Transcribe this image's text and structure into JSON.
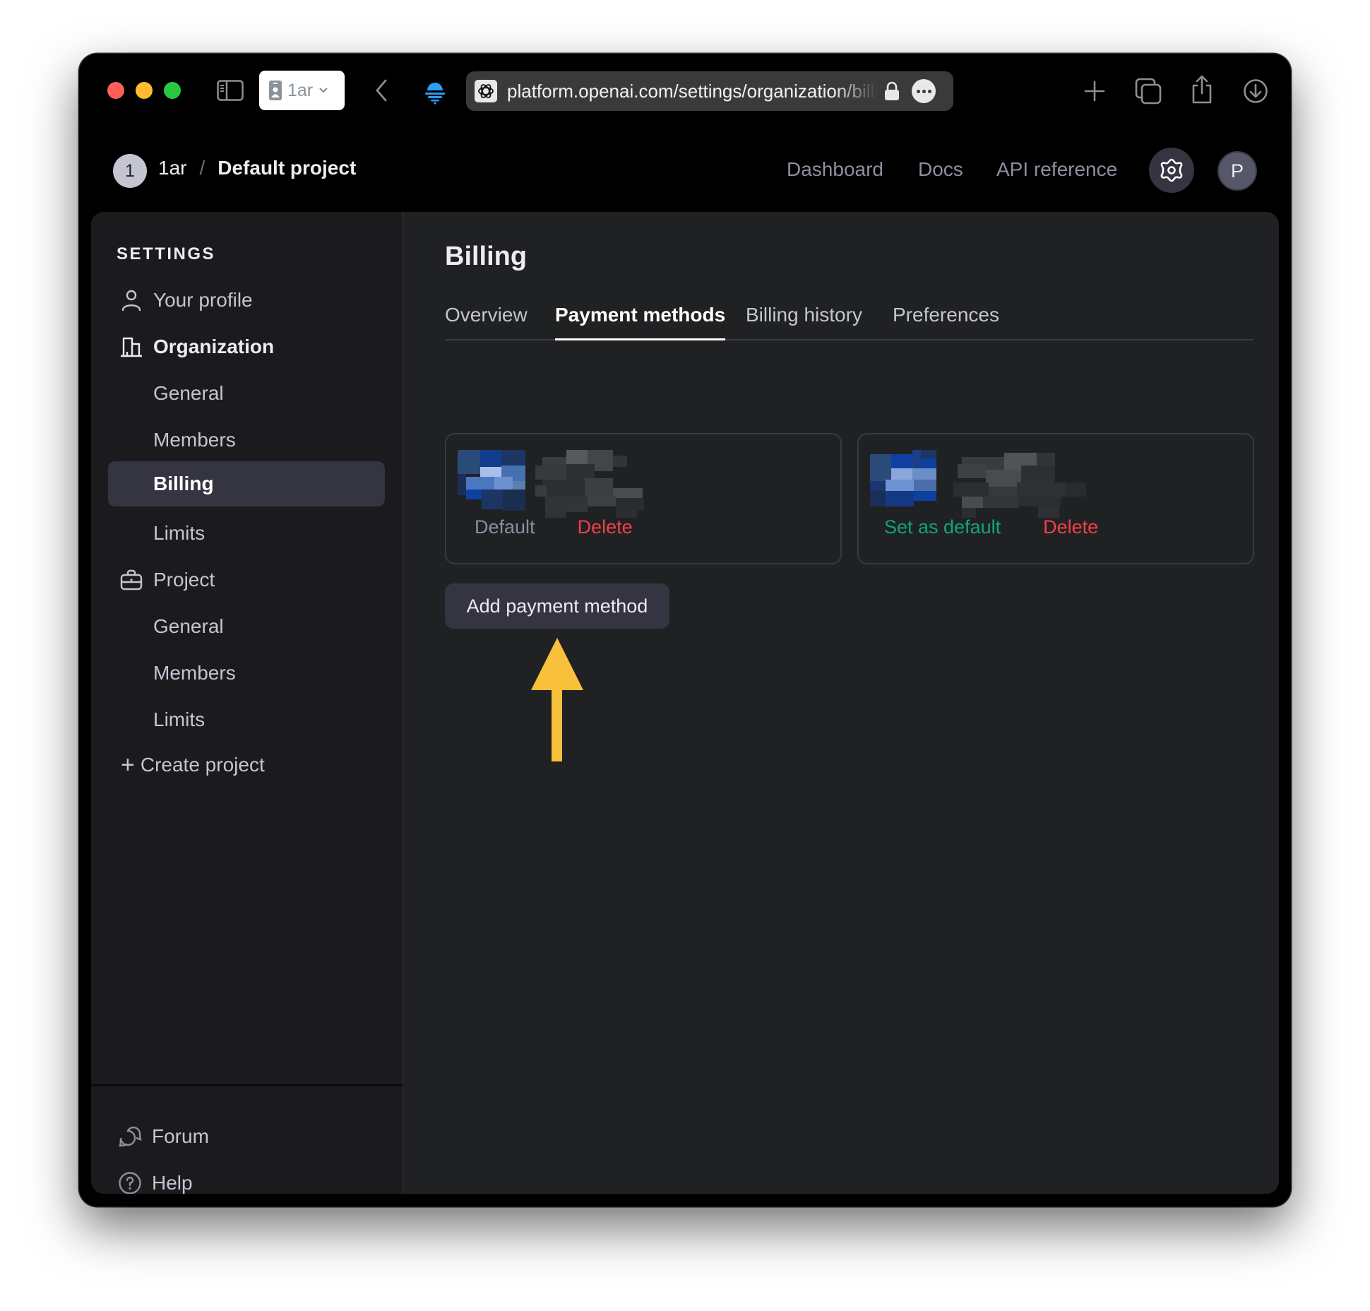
{
  "browser": {
    "profile_label": "1ar",
    "url": "platform.openai.com/settings/organization/billing/payment-methods",
    "icons": {
      "sidebar_toggle": "sidebar-icon",
      "back": "chevron-left-icon",
      "vpn": "vpn-icon",
      "favicon": "openai-logo-icon",
      "lock": "lock-icon",
      "more": "ellipsis-icon",
      "new_tab": "plus-icon",
      "tab_overview": "tabs-icon",
      "share": "share-icon",
      "downloads": "download-icon"
    }
  },
  "header": {
    "org_badge": "1",
    "org_name": "1ar",
    "separator": "/",
    "project_name": "Default project",
    "nav": [
      "Dashboard",
      "Docs",
      "API reference"
    ],
    "avatar_initial": "P"
  },
  "sidebar": {
    "heading": "SETTINGS",
    "your_profile": "Your profile",
    "organization": {
      "label": "Organization",
      "items": [
        "General",
        "Members",
        "Billing",
        "Limits"
      ]
    },
    "project": {
      "label": "Project",
      "items": [
        "General",
        "Members",
        "Limits"
      ]
    },
    "create_project": "Create project",
    "footer": [
      "Forum",
      "Help"
    ],
    "active_item": "Billing"
  },
  "main": {
    "title": "Billing",
    "tabs": [
      {
        "label": "Overview",
        "active": false
      },
      {
        "label": "Payment methods",
        "active": true
      },
      {
        "label": "Billing history",
        "active": false
      },
      {
        "label": "Preferences",
        "active": false
      }
    ],
    "payment_methods": [
      {
        "details": "[redacted card]",
        "status": "Default",
        "delete_label": "Delete"
      },
      {
        "details": "[redacted card]",
        "action": "Set as default",
        "delete_label": "Delete"
      }
    ],
    "add_button": "Add payment method"
  },
  "colors": {
    "delete": "#ef4146",
    "set_default": "#10a37f",
    "annotation_arrow": "#f8c03b",
    "active_nav_bg": "#343541"
  }
}
